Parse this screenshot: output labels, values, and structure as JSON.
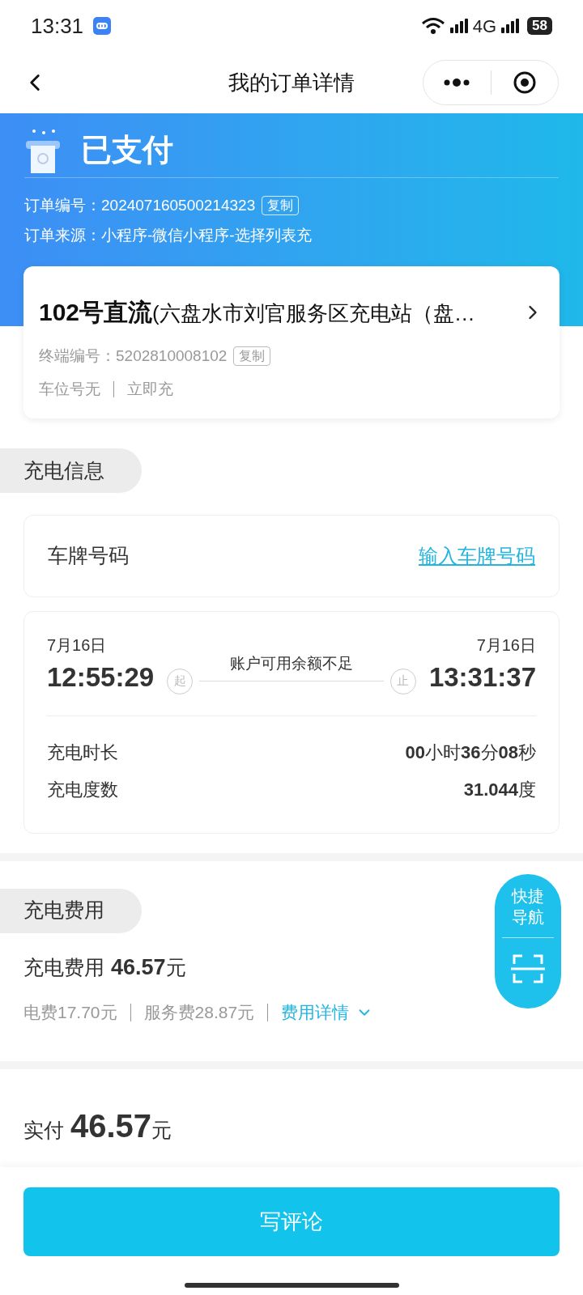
{
  "status_bar": {
    "time": "13:31",
    "network": "4G",
    "battery": "58"
  },
  "nav": {
    "title": "我的订单详情"
  },
  "header": {
    "status": "已支付",
    "order_no_label": "订单编号：",
    "order_no": "202407160500214323",
    "copy": "复制",
    "source_label": "订单来源：",
    "source": "小程序-微信小程序-选择列表充"
  },
  "station": {
    "title": "**102号直流**(六盘水市刘官服务区充电站（盘…",
    "terminal_label": "终端编号：",
    "terminal": "5202810008102",
    "copy": "复制",
    "parking": "车位号无",
    "mode": "立即充"
  },
  "charging_info": {
    "section": "充电信息",
    "plate_label": "车牌号码",
    "plate_link": "输入车牌号码",
    "start": {
      "date": "7月16日",
      "time": "12:55:29",
      "badge": "起"
    },
    "end": {
      "date": "7月16日",
      "time": "13:31:37",
      "badge": "止"
    },
    "reason": "账户可用余额不足",
    "rows": [
      {
        "label": "充电时长",
        "value": "**00**小时**36**分**08**秒"
      },
      {
        "label": "充电度数",
        "value": "**31.044**度"
      }
    ]
  },
  "fees": {
    "section": "充电费用",
    "total_label": "充电费用",
    "total": "46.57",
    "unit": "元",
    "electricity": "电费17.70元",
    "service": "服务费28.87元",
    "details": "费用详情"
  },
  "quick_nav": {
    "label": "快捷导航"
  },
  "paid": {
    "label": "实付",
    "amount": "46.57",
    "unit": "元"
  },
  "action": {
    "label": "写评论"
  }
}
